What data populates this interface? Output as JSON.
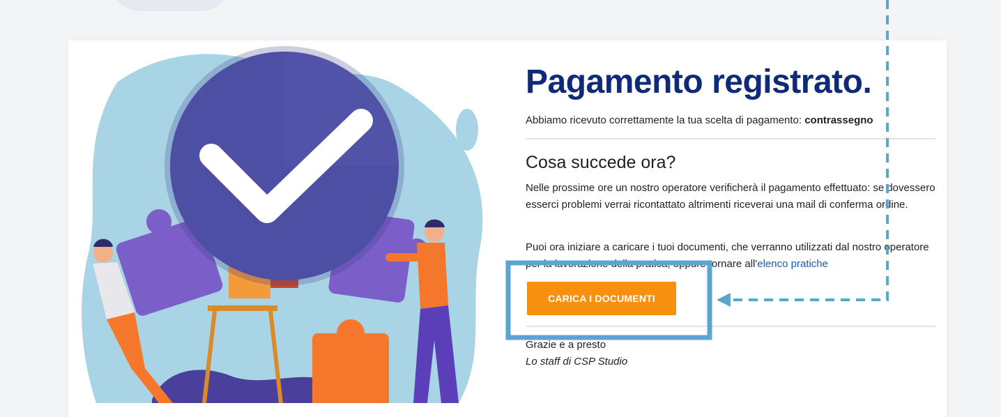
{
  "confirmation": {
    "title": "Pagamento registrato.",
    "received_text": "Abbiamo ricevuto correttamente la tua scelta di pagamento: ",
    "payment_method": "contrassegno",
    "subtitle": "Cosa succede ora?",
    "paragraph_1": "Nelle prossime ore un nostro operatore verificherà il pagamento effettuato: se dovessero esserci problemi verrai ricontattato altrimenti riceverai una mail di conferma ordine.",
    "paragraph_2_text": "Puoi ora iniziare a caricare i tuoi documenti, che verranno utilizzati dal nostro operatore per la lavorazione della pratica, oppure tornare all'",
    "paragraph_2_link": "elenco pratiche",
    "button_label": "CARICA I DOCUMENTI",
    "closing": "Grazie e a presto",
    "signature": "Lo staff di CSP Studio"
  },
  "colors": {
    "title": "#0f2a78",
    "button": "#f7900f",
    "highlight": "#5aa6cf",
    "check_circle": "#4c4fa3",
    "blob": "#a8d4e6"
  },
  "icons": {
    "check": "check-icon",
    "arrow": "arrow-left-icon"
  }
}
